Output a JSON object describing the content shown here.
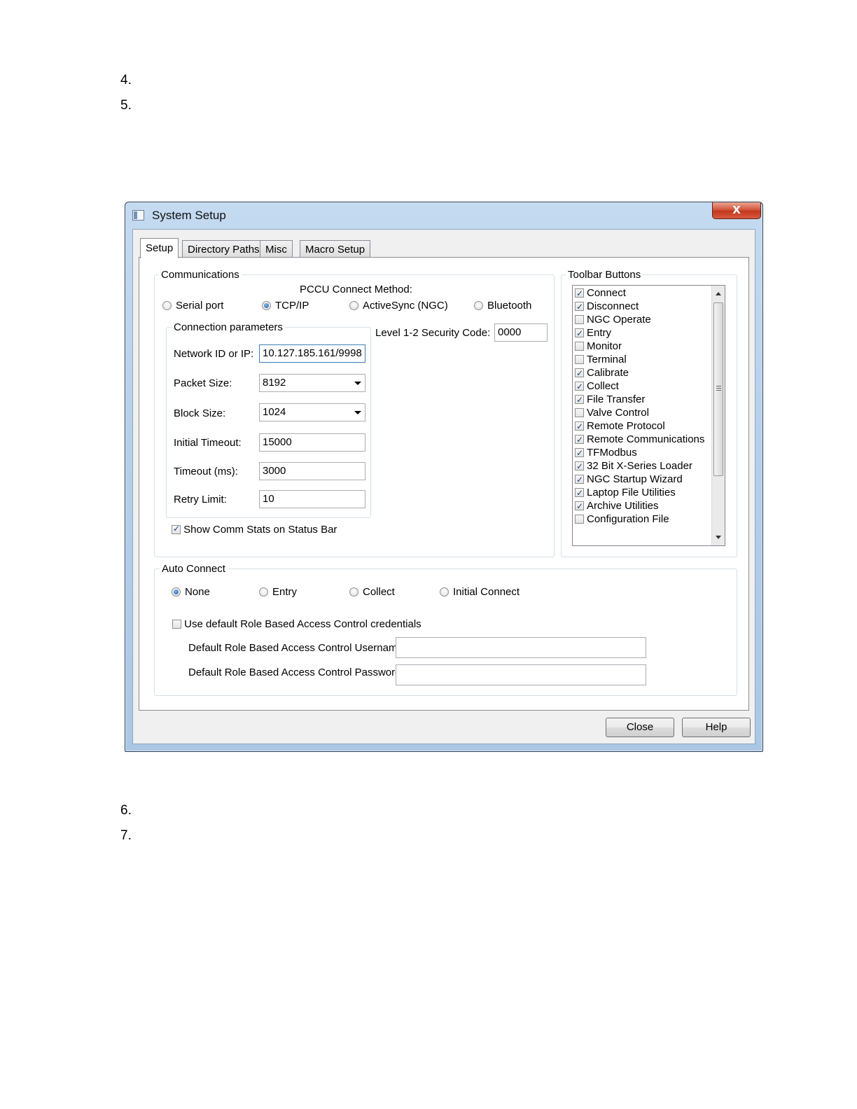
{
  "doc": {
    "numbers": [
      "4.",
      "5.",
      "6.",
      "7."
    ]
  },
  "window": {
    "title": "System Setup",
    "close_glyph": "X"
  },
  "tabs": [
    "Setup",
    "Directory Paths",
    "Misc",
    "Macro Setup"
  ],
  "communications": {
    "label": "Communications",
    "method_label": "PCCU Connect Method:",
    "methods": [
      "Serial port",
      "TCP/IP",
      "ActiveSync (NGC)",
      "Bluetooth"
    ],
    "selected_method": "TCP/IP",
    "security_label": "Level 1-2 Security Code:",
    "security_code": "0000",
    "params": {
      "label": "Connection parameters",
      "network_label": "Network ID or IP:",
      "network_value": "10.127.185.161/9998",
      "packet_label": "Packet Size:",
      "packet_value": "8192",
      "block_label": "Block Size:",
      "block_value": "1024",
      "initial_timeout_label": "Initial Timeout:",
      "initial_timeout_value": "15000",
      "timeout_label": "Timeout (ms):",
      "timeout_value": "3000",
      "retry_label": "Retry Limit:",
      "retry_value": "10"
    },
    "show_stats_label": "Show Comm Stats on Status Bar",
    "show_stats_checked": true
  },
  "toolbar": {
    "label": "Toolbar Buttons",
    "items": [
      {
        "label": "Connect",
        "checked": true
      },
      {
        "label": "Disconnect",
        "checked": true
      },
      {
        "label": "NGC Operate",
        "checked": false
      },
      {
        "label": "Entry",
        "checked": true
      },
      {
        "label": "Monitor",
        "checked": false
      },
      {
        "label": "Terminal",
        "checked": false
      },
      {
        "label": "Calibrate",
        "checked": true
      },
      {
        "label": "Collect",
        "checked": true
      },
      {
        "label": "File Transfer",
        "checked": true
      },
      {
        "label": "Valve Control",
        "checked": false
      },
      {
        "label": "Remote Protocol",
        "checked": true
      },
      {
        "label": "Remote Communications",
        "checked": true
      },
      {
        "label": "TFModbus",
        "checked": true
      },
      {
        "label": "32 Bit X-Series Loader",
        "checked": true
      },
      {
        "label": "NGC Startup Wizard",
        "checked": true
      },
      {
        "label": "Laptop File Utilities",
        "checked": true
      },
      {
        "label": "Archive Utilities",
        "checked": true
      },
      {
        "label": "Configuration File",
        "checked": false
      }
    ]
  },
  "auto_connect": {
    "label": "Auto Connect",
    "options": [
      "None",
      "Entry",
      "Collect",
      "Initial Connect"
    ],
    "selected": "None",
    "rbac_label": "Use default Role Based Access Control credentials",
    "rbac_checked": false,
    "username_label": "Default Role Based Access Control Username",
    "username_value": "",
    "password_label": "Default Role Based Access Control Password",
    "password_value": ""
  },
  "buttons": {
    "close": "Close",
    "help": "Help"
  }
}
